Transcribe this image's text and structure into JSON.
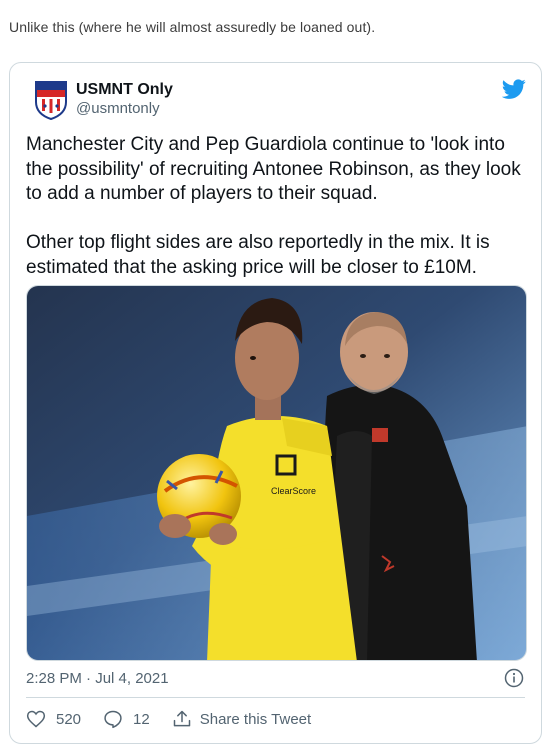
{
  "post": {
    "intro_text": "Unlike this (where he will almost assuredly be loaned out)."
  },
  "tweet": {
    "author_name": "USMNT Only",
    "author_handle": "@usmntonly",
    "avatar_text_top": "USMNT",
    "avatar_text_mid": "ONLY",
    "paragraphs": [
      "Manchester City and Pep Guardiola continue to 'look into the possibility' of recruiting Antonee Robinson, as they look to add a number of players to their squad.",
      "Other top flight sides are also reportedly in the mix. It is estimated that the asking price will be closer to £10M."
    ],
    "timestamp": "2:28 PM · Jul 4, 2021",
    "likes": "520",
    "replies": "12",
    "share_label": "Share this Tweet",
    "shirt_sponsor": "ClearScore",
    "colors": {
      "twitter_blue": "#1d9bf0",
      "text": "#0f1419",
      "muted": "#536471",
      "border": "#cfd9de"
    },
    "icons": {
      "brand": "twitter-bird-icon",
      "info": "info-icon",
      "like": "heart-icon",
      "reply": "reply-icon",
      "share": "share-icon"
    }
  }
}
